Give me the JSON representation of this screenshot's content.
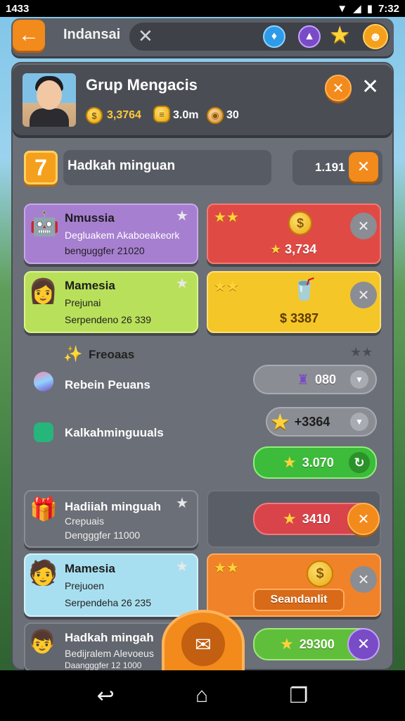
{
  "status_bar": {
    "time_left": "1433",
    "time_right": "7:32"
  },
  "top_bar": {
    "title": "Indansai",
    "clear_symbol": "✕"
  },
  "profile": {
    "name": "Grup Mengacis",
    "coins": "3,3764",
    "chips": "3.0m",
    "cups": "30"
  },
  "section": {
    "level": "7",
    "title": "Hadkah minguan",
    "count": "1.191"
  },
  "cards": [
    {
      "title": "Nmussia",
      "line1": "Degluakem Akaboeakeork",
      "line2": "benguggfer 21020",
      "bg": "#a77fd0"
    },
    {
      "title": "Mamesia",
      "line1": "Prejunai",
      "line2": "Serpendeno 26 339",
      "bg": "#b9e05a"
    },
    {
      "title": "Hadiiah minguah",
      "line1": "Crepuais",
      "line2": "Dengggfer 11000",
      "bg": "#6b6f77"
    },
    {
      "title": "Mamesia",
      "line1": "Prejuoen",
      "line2": "Serpendeha 26 235",
      "bg": "#a8dff0"
    },
    {
      "title": "Hadkah mingah",
      "line1": "Bedijralem Alevoeus",
      "line2": "Daangggfer 12 1000",
      "bg": "#62666e"
    }
  ],
  "rewards": [
    {
      "value": "3,734",
      "bg": "#e04a45"
    },
    {
      "value": "$ 3387",
      "bg": "#f5c628"
    },
    {
      "value": "Seandanlit",
      "bg": "#f0822a"
    }
  ],
  "list_section": {
    "header": "Freoaas",
    "items": [
      {
        "label": "Rebein Peuans",
        "value": "080"
      },
      {
        "label": "Kalkahminguuals",
        "value": "+3364",
        "value2": "3.070"
      }
    ]
  },
  "pills": [
    {
      "value": "3410"
    },
    {
      "value": "29300"
    }
  ]
}
